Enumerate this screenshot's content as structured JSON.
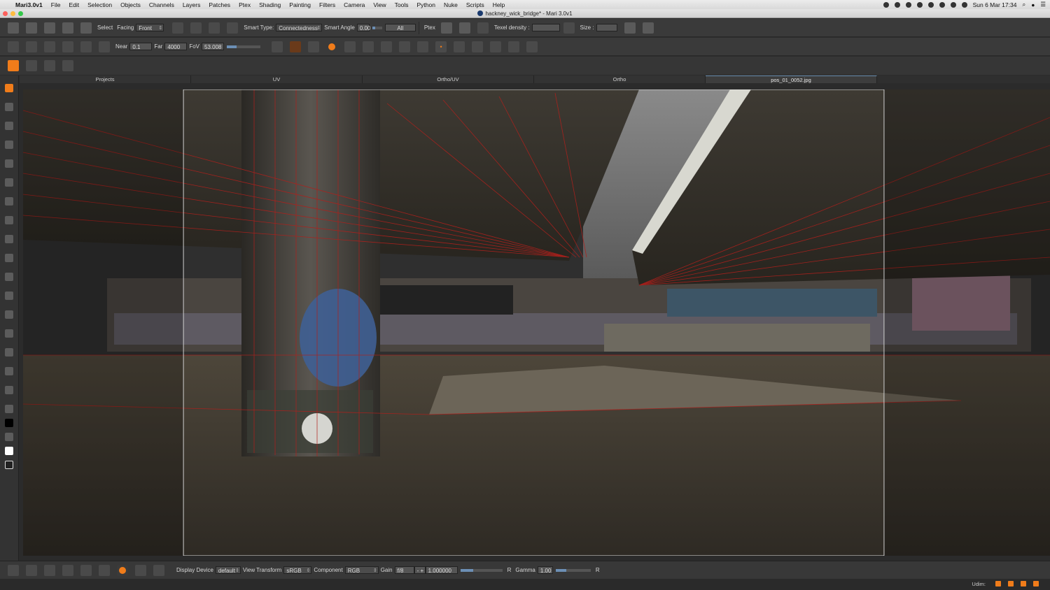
{
  "menubar": {
    "app_name": "Mari3.0v1",
    "items": [
      "File",
      "Edit",
      "Selection",
      "Objects",
      "Channels",
      "Layers",
      "Patches",
      "Ptex",
      "Shading",
      "Painting",
      "Filters",
      "Camera",
      "View",
      "Tools",
      "Python",
      "Nuke",
      "Scripts",
      "Help"
    ],
    "clock": "Sun 6 Mar  17:34"
  },
  "window": {
    "title": "hackney_wick_bridge* - Mari 3.0v1"
  },
  "toolbar1": {
    "select_label": "Select",
    "facing_label": "Facing",
    "facing_value": "Front",
    "smart_type_label": "Smart Type:",
    "smart_type_value": "Connectedness",
    "smart_angle_label": "Smart Angle",
    "smart_angle_value": "0.00",
    "all_value": "All",
    "ptex_label": "Ptex",
    "texel_density_label": "Texel density :",
    "size_label": "Size :"
  },
  "toolbar2": {
    "near_label": "Near",
    "near_value": "0.1",
    "far_label": "Far",
    "far_value": "4000",
    "fov_label": "FoV",
    "fov_value": "53.008"
  },
  "tabs": [
    {
      "label": "Projects",
      "active": false
    },
    {
      "label": "UV",
      "active": false
    },
    {
      "label": "Ortho/UV",
      "active": false
    },
    {
      "label": "Ortho",
      "active": false
    },
    {
      "label": "pos_01_0052.jpg",
      "active": true
    }
  ],
  "bottom": {
    "display_device_label": "Display Device",
    "display_device_value": "default",
    "view_transform_label": "View Transform",
    "view_transform_value": "sRGB",
    "component_label": "Component",
    "component_value": "RGB",
    "gain_label": "Gain",
    "gain_value": "f/8",
    "gain_number": "1.000000",
    "r_label": "R",
    "gamma_label": "Gamma",
    "gamma_value": "1.00",
    "r2_label": "R"
  },
  "status": {
    "udim_label": "Udim:"
  },
  "colors": {
    "accent": "#f07c1a",
    "wire": "#b0201c",
    "highlight": "#6b8fb0"
  }
}
